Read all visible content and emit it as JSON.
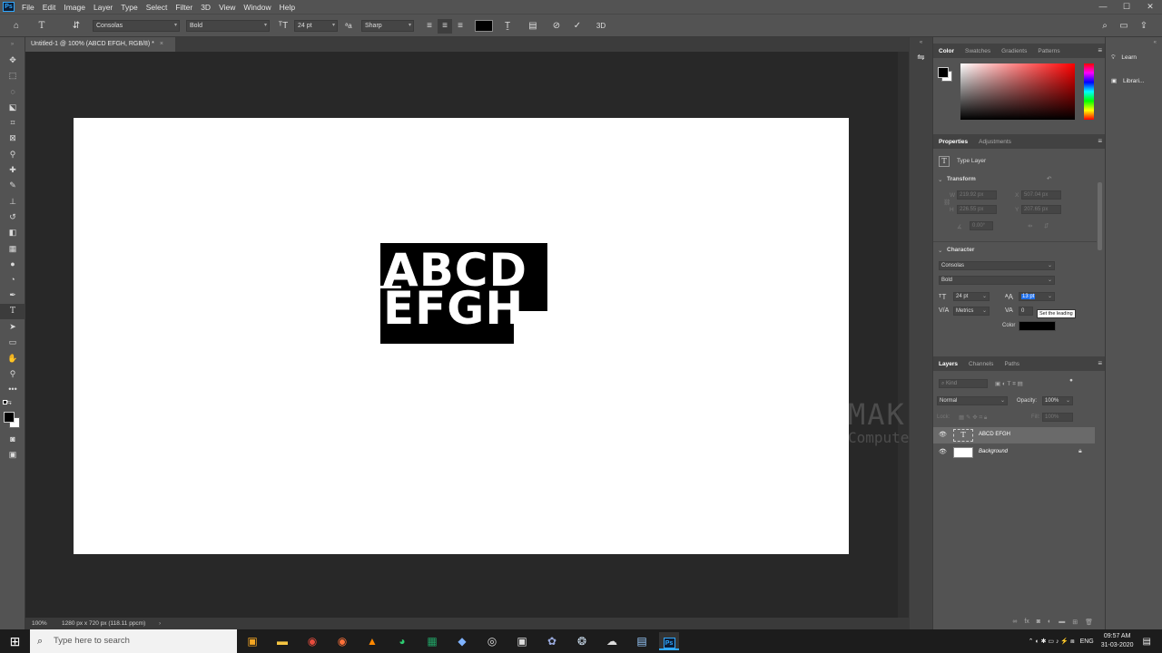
{
  "menubar": {
    "logo": "Ps",
    "items": [
      "File",
      "Edit",
      "Image",
      "Layer",
      "Type",
      "Select",
      "Filter",
      "3D",
      "View",
      "Window",
      "Help"
    ]
  },
  "options_bar": {
    "font_family": "Consolas",
    "font_style": "Bold",
    "font_size": "24 pt",
    "anti_alias": "Sharp",
    "text_color": "#000000"
  },
  "document": {
    "tab_title": "Untitled-1 @ 100% (ABCD EFGH, RGB/8) *",
    "text_line1": "ABCD",
    "text_line2": "EFGH"
  },
  "status": {
    "zoom": "100%",
    "doc_info": "1280 px x 720 px (118.11 ppcm)"
  },
  "color_panel": {
    "tabs": [
      "Color",
      "Swatches",
      "Gradients",
      "Patterns"
    ],
    "fg": "#000000",
    "bg": "#ffffff",
    "hue": "#ff0000"
  },
  "properties_panel": {
    "tabs": [
      "Properties",
      "Adjustments"
    ],
    "layer_type": "Type Layer",
    "transform_label": "Transform",
    "w": "219.92 px",
    "x": "507.04 px",
    "h": "226.55 px",
    "y": "207.65 px",
    "angle": "0.00°",
    "character_label": "Character",
    "font_family": "Consolas",
    "font_style": "Bold",
    "size": "24 pt",
    "leading": "13 pt",
    "kerning": "Metrics",
    "tracking": "0",
    "tooltip": "Set the leading",
    "color_label": "Color",
    "color": "#000000"
  },
  "layers_panel": {
    "tabs": [
      "Layers",
      "Channels",
      "Paths"
    ],
    "kind_placeholder": "Kind",
    "blend_mode": "Normal",
    "opacity_label": "Opacity:",
    "opacity": "100%",
    "lock_label": "Lock:",
    "fill_label": "Fill:",
    "fill": "100%",
    "layers": [
      {
        "name": "ABCD EFGH",
        "type": "text"
      },
      {
        "name": "Background",
        "type": "image"
      }
    ]
  },
  "right_strip": {
    "learn": "Learn",
    "libraries": "Librari..."
  },
  "watermark": {
    "line1": "MAK STUDIO",
    "line2": "Computer Tutorial"
  },
  "taskbar": {
    "search_placeholder": "Type here to search",
    "language": "ENG",
    "time": "09:57 AM",
    "date": "31-03-2020"
  }
}
